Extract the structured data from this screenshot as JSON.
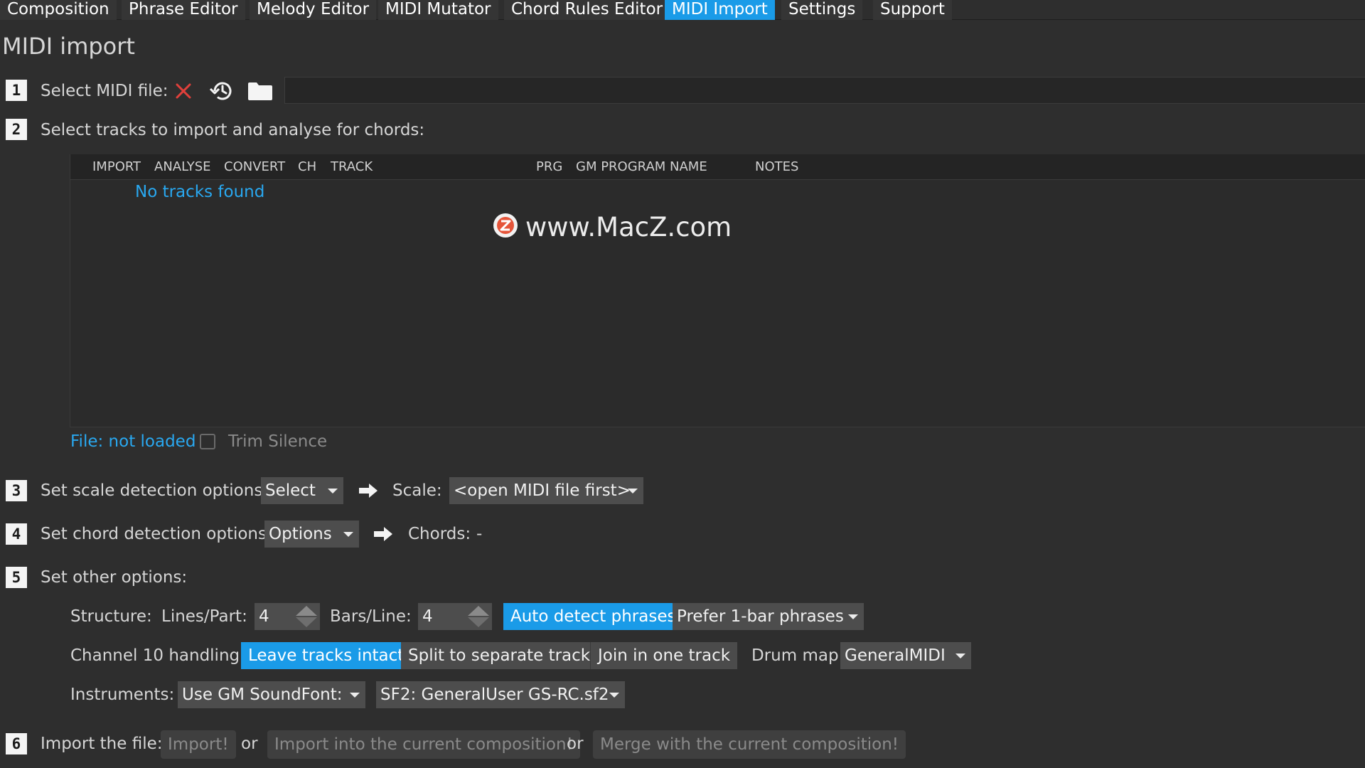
{
  "tabs": [
    {
      "label": "Composition"
    },
    {
      "label": "Phrase Editor"
    },
    {
      "label": "Melody Editor"
    },
    {
      "label": "MIDI Mutator"
    },
    {
      "label": "Chord Rules Editor"
    },
    {
      "label": "MIDI Import",
      "active": true
    },
    {
      "label": "Settings"
    },
    {
      "label": "Support"
    }
  ],
  "page": {
    "title": "MIDI import"
  },
  "steps": {
    "s1": {
      "num": "1",
      "label": "Select MIDI file:",
      "file_path": ""
    },
    "s2": {
      "num": "2",
      "label": "Select tracks to import and analyse for chords:"
    },
    "s3": {
      "num": "3",
      "label": "Set scale detection options:",
      "dropdown": "Select",
      "scale_label": "Scale:",
      "scale_value": "<open MIDI file first>"
    },
    "s4": {
      "num": "4",
      "label": "Set chord detection options:",
      "dropdown": "Options",
      "chords_label": "Chords:",
      "chords_value": "-"
    },
    "s5": {
      "num": "5",
      "label": "Set other options:"
    },
    "s6": {
      "num": "6",
      "label": "Import the file:",
      "import_btn": "Import!",
      "or1": "or",
      "import_current_btn": "Import into the current composition!",
      "or2": "or",
      "merge_btn": "Merge with the current composition!"
    }
  },
  "table": {
    "columns": [
      "IMPORT",
      "ANALYSE",
      "CONVERT",
      "CH",
      "TRACK",
      "PRG",
      "GM PROGRAM NAME",
      "NOTES"
    ],
    "empty_message": "No tracks found",
    "rows": []
  },
  "watermark": "www.MacZ.com",
  "file_status": "File: not loaded",
  "trim_silence": {
    "label": "Trim Silence",
    "checked": false
  },
  "structure": {
    "label": "Structure:",
    "lines_label": "Lines/Part:",
    "lines_value": "4",
    "bars_label": "Bars/Line:",
    "bars_value": "4",
    "auto_detect": "Auto detect phrases",
    "phrase_pref": "Prefer 1-bar phrases"
  },
  "channel10": {
    "label": "Channel 10 handling:",
    "options": [
      "Leave tracks intact",
      "Split to separate tracks",
      "Join in one track"
    ],
    "selected": "Leave tracks intact",
    "drum_map_label": "Drum map:",
    "drum_map_value": "GeneralMIDI"
  },
  "instruments": {
    "label": "Instruments:",
    "source": "Use GM SoundFont:",
    "soundfont": "SF2: GeneralUser GS-RC.sf2"
  },
  "colors": {
    "accent": "#1a9be8",
    "link": "#29a8f0",
    "clear_icon": "#e0403b"
  }
}
